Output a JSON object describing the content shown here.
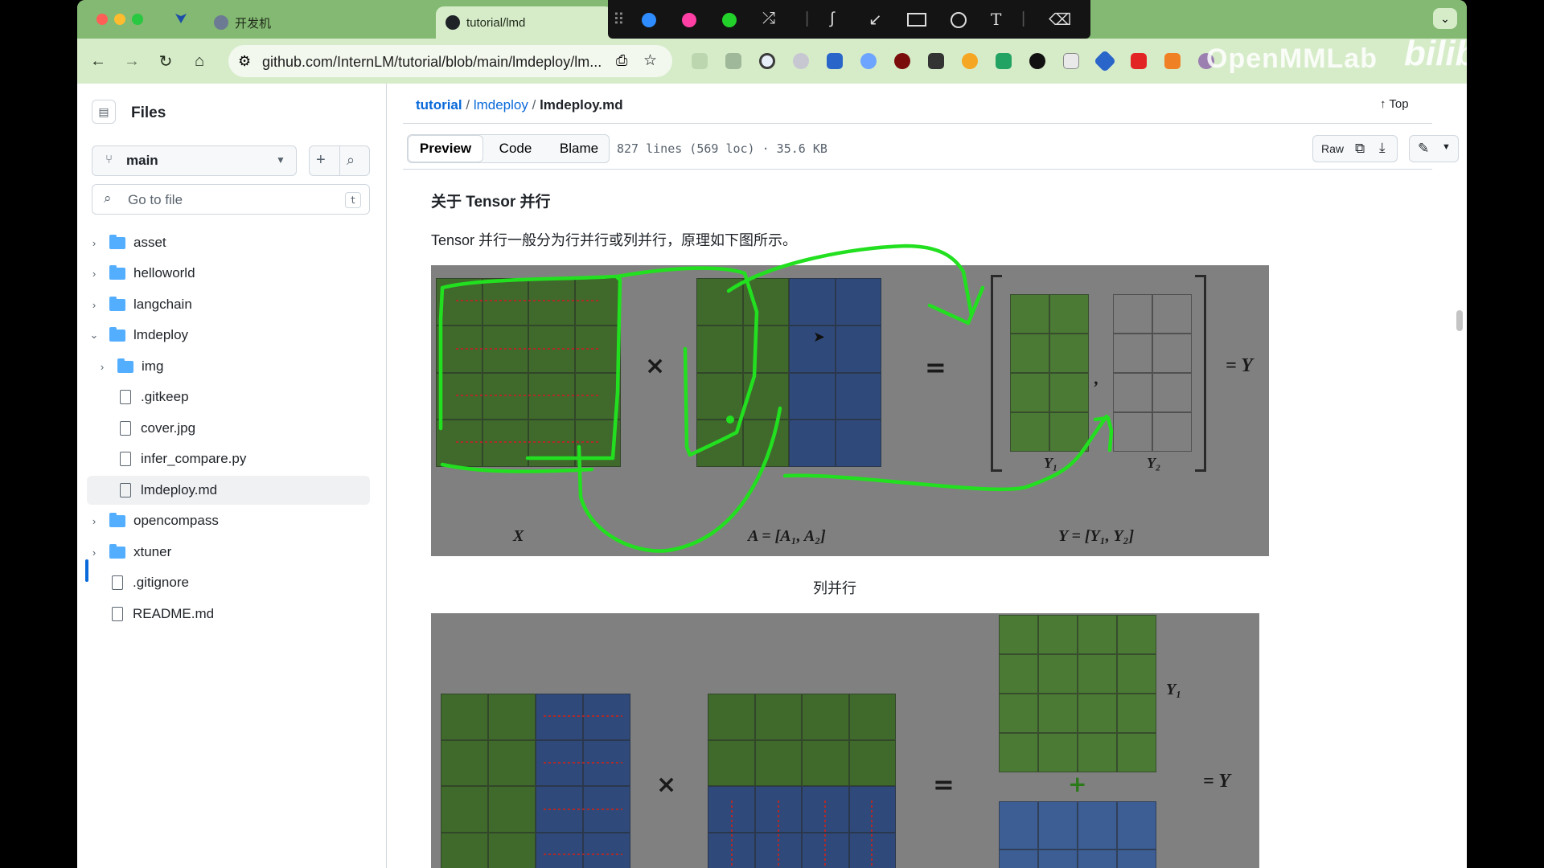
{
  "browser": {
    "tabs": [
      {
        "label": "开发机"
      },
      {
        "label": "tutorial/lmd"
      }
    ],
    "url": "github.com/InternLM/tutorial/blob/main/lmdeploy/lm...",
    "watermark": "OpenMMLab",
    "logo": "bilibili"
  },
  "sidebar": {
    "title": "Files",
    "branch": "main",
    "search_placeholder": "Go to file",
    "search_shortcut": "t",
    "tree": [
      {
        "label": "asset",
        "type": "folder"
      },
      {
        "label": "helloworld",
        "type": "folder"
      },
      {
        "label": "langchain",
        "type": "folder"
      },
      {
        "label": "lmdeploy",
        "type": "folder-open"
      },
      {
        "label": "img",
        "type": "folder"
      },
      {
        "label": ".gitkeep",
        "type": "file"
      },
      {
        "label": "cover.jpg",
        "type": "file"
      },
      {
        "label": "infer_compare.py",
        "type": "file"
      },
      {
        "label": "lmdeploy.md",
        "type": "file",
        "selected": true
      },
      {
        "label": "opencompass",
        "type": "folder"
      },
      {
        "label": "xtuner",
        "type": "folder"
      },
      {
        "label": ".gitignore",
        "type": "file"
      },
      {
        "label": "README.md",
        "type": "file"
      }
    ]
  },
  "main": {
    "breadcrumb": {
      "root": "tutorial",
      "sep": "/",
      "dir": "lmdeploy",
      "file": "lmdeploy.md"
    },
    "top_label": "Top",
    "tabs": [
      "Preview",
      "Code",
      "Blame"
    ],
    "file_info": "827 lines (569 loc) · 35.6 KB",
    "raw_label": "Raw",
    "heading": "关于 Tensor 并行",
    "paragraph": "Tensor 并行一般分为行并行或列并行，原理如下图所示。",
    "caption": "列并行",
    "fig1": {
      "x_label": "X",
      "times": "×",
      "a_label": "A = [A₁, A₂]",
      "equals": "=",
      "y1": "Y₁",
      "y2": "Y₂",
      "y_label": "Y = [Y₁, Y₂]",
      "eq_y": "= Y"
    },
    "fig2": {
      "times": "×",
      "equals": "=",
      "plus": "+",
      "y1": "Y₁",
      "eq_y": "= Y"
    }
  },
  "colors": {
    "tabbar": "#83b972",
    "green_block": "#3f6a2c",
    "blue_block": "#2f4a7a",
    "annotation": "#22e01f",
    "link": "#0969da"
  }
}
